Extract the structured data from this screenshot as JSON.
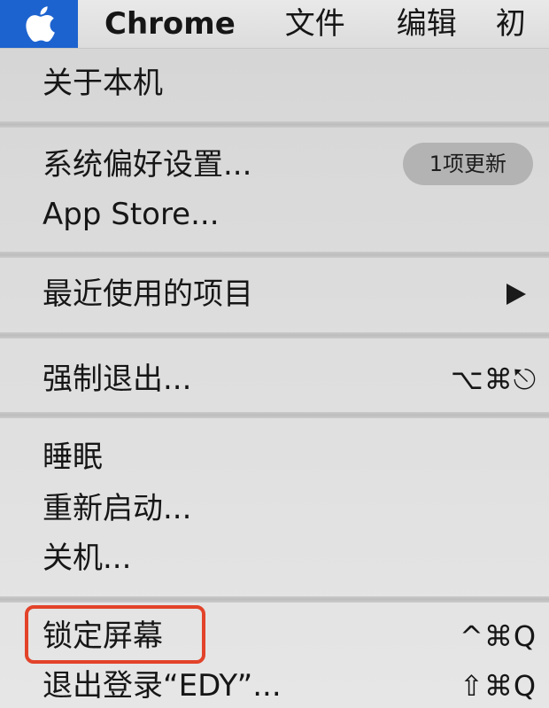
{
  "menubar": {
    "apple_icon": "apple-icon",
    "app_name": "Chrome",
    "items": [
      "文件",
      "编辑",
      "初"
    ]
  },
  "menu": {
    "about": "关于本机",
    "system_prefs": "系统偏好设置...",
    "update_badge": "1项更新",
    "app_store": "App Store...",
    "recent_items": "最近使用的项目",
    "force_quit": "强制退出...",
    "force_quit_shortcut": "⌥⌘⎋",
    "sleep": "睡眠",
    "restart": "重新启动...",
    "shutdown": "关机...",
    "lock_screen": "锁定屏幕",
    "lock_screen_shortcut": "^⌘Q",
    "logout": "退出登录“EDY”...",
    "logout_shortcut": "⇧⌘Q"
  },
  "colors": {
    "menubar_highlight": "#1d63cf",
    "annotation_box": "#e2432a"
  }
}
